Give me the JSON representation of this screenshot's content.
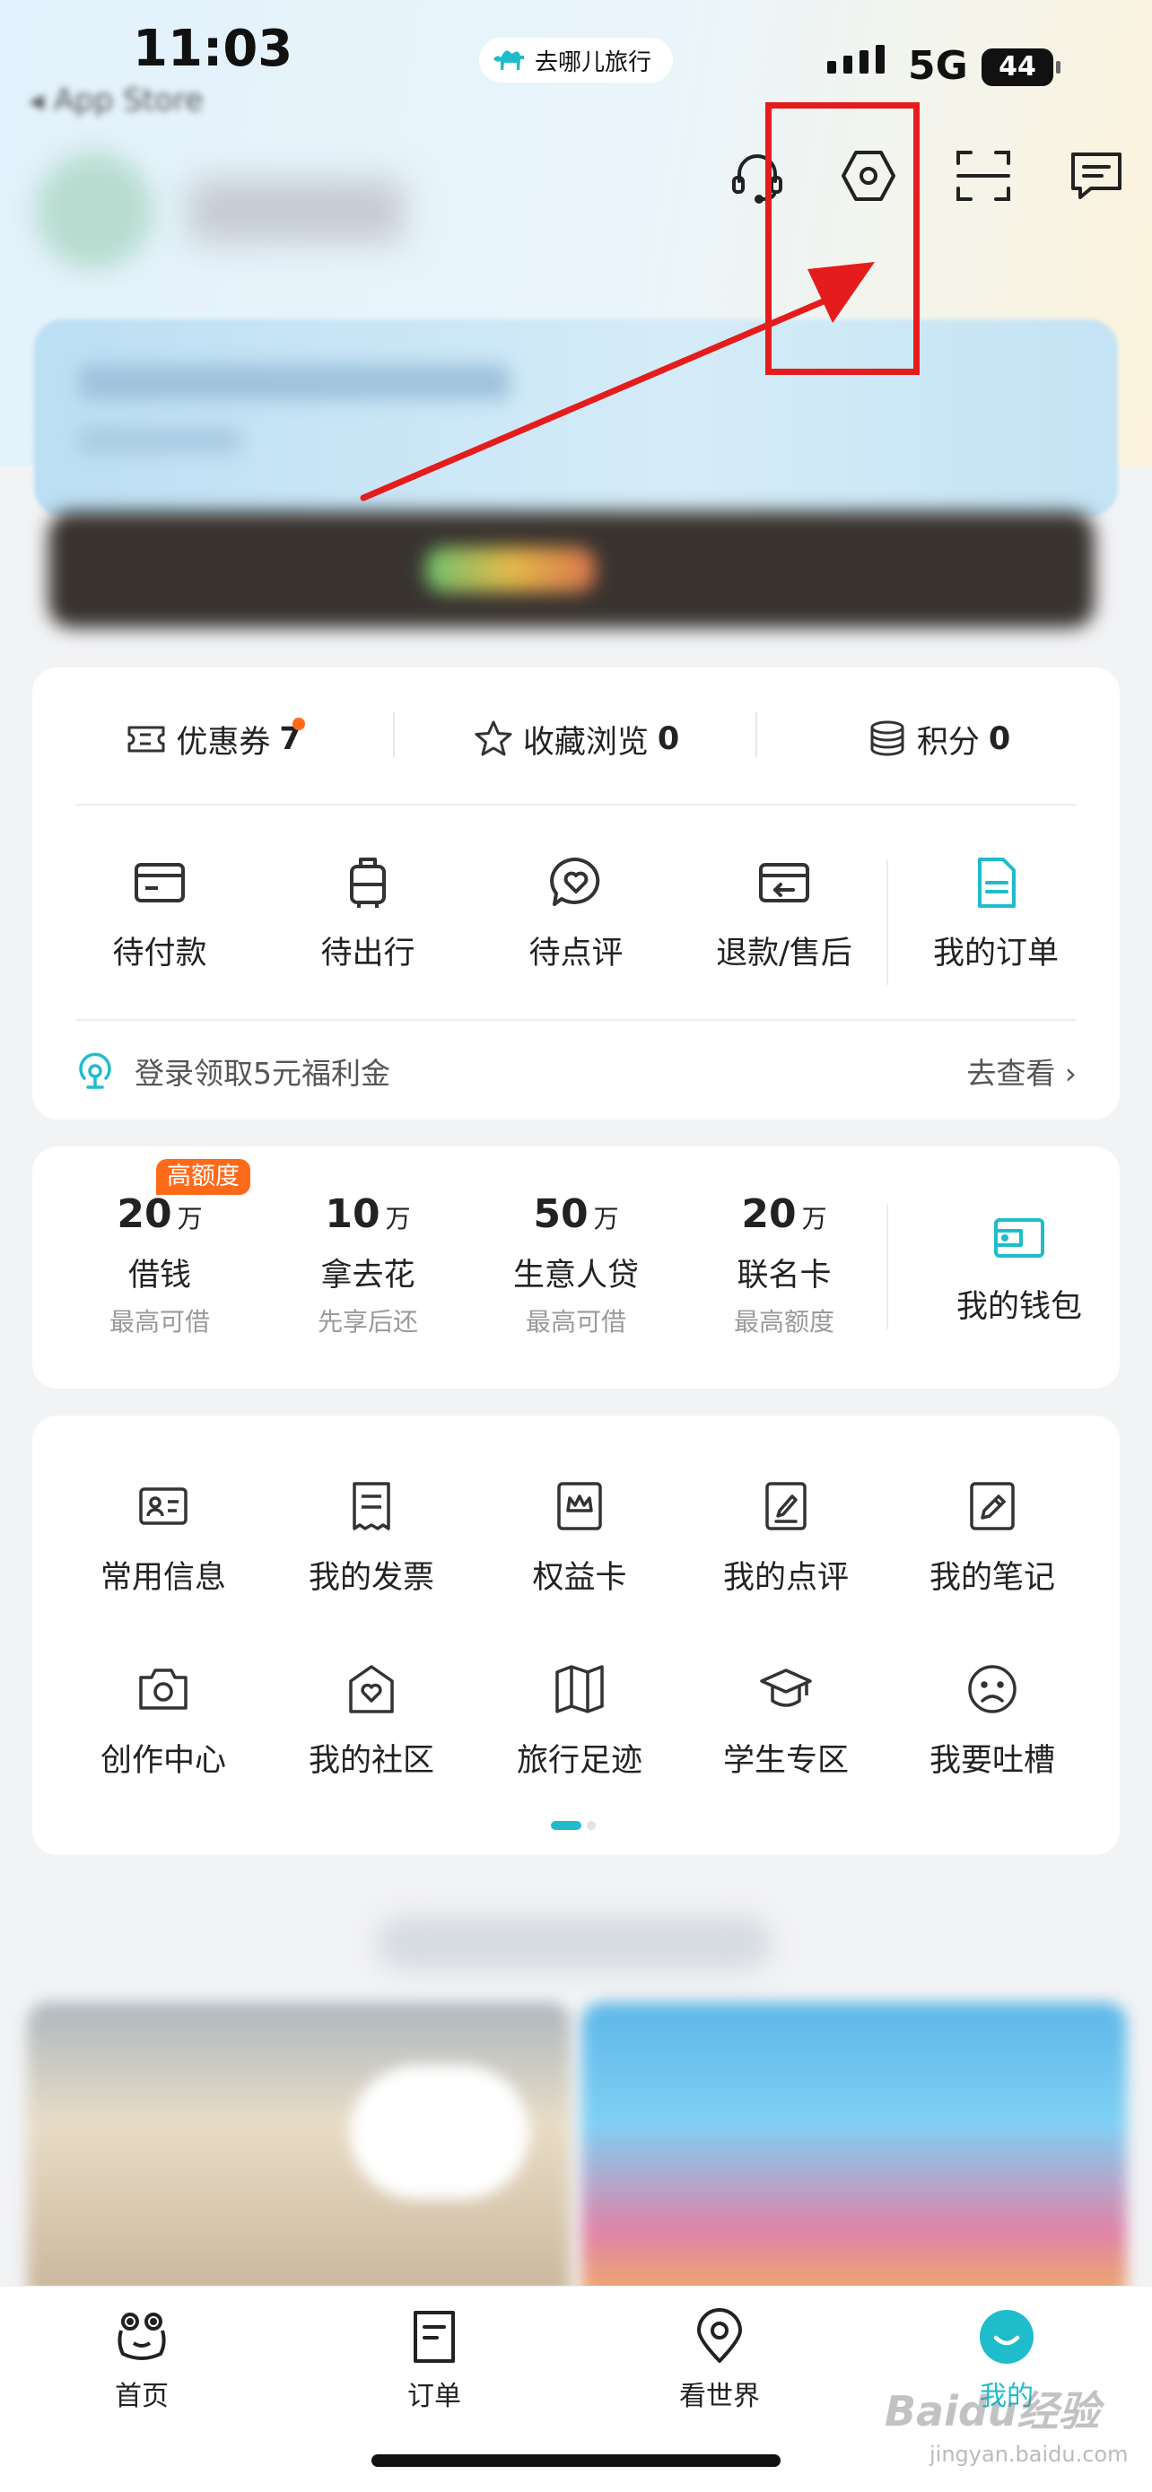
{
  "status_bar": {
    "time": "11:03",
    "back_label": "◂ App Store",
    "app_name": "去哪儿旅行",
    "network": "5G",
    "battery": "44"
  },
  "header": {
    "icons": [
      "headset-icon",
      "settings-icon",
      "scan-icon",
      "message-icon"
    ]
  },
  "stats": {
    "coupons_label": "优惠券",
    "coupons_count": "7",
    "favorites_label": "收藏浏览",
    "favorites_count": "0",
    "points_label": "积分",
    "points_count": "0"
  },
  "orders": {
    "items": [
      {
        "label": "待付款",
        "icon": "card-icon"
      },
      {
        "label": "待出行",
        "icon": "luggage-icon"
      },
      {
        "label": "待点评",
        "icon": "review-heart-icon"
      },
      {
        "label": "退款/售后",
        "icon": "refund-icon"
      },
      {
        "label": "我的订单",
        "icon": "order-doc-icon"
      }
    ],
    "promo_text": "登录领取5元福利金",
    "promo_link": "去查看 ›"
  },
  "finance": {
    "badge": "高额度",
    "items": [
      {
        "amount": "20",
        "unit": "万",
        "name": "借钱",
        "sub": "最高可借"
      },
      {
        "amount": "10",
        "unit": "万",
        "name": "拿去花",
        "sub": "先享后还"
      },
      {
        "amount": "50",
        "unit": "万",
        "name": "生意人贷",
        "sub": "最高可借"
      },
      {
        "amount": "20",
        "unit": "万",
        "name": "联名卡",
        "sub": "最高额度"
      }
    ],
    "wallet_label": "我的钱包"
  },
  "services": {
    "items": [
      {
        "label": "常用信息",
        "icon": "id-card-icon"
      },
      {
        "label": "我的发票",
        "icon": "invoice-icon"
      },
      {
        "label": "权益卡",
        "icon": "crown-card-icon"
      },
      {
        "label": "我的点评",
        "icon": "edit-doc-icon"
      },
      {
        "label": "我的笔记",
        "icon": "pencil-icon"
      },
      {
        "label": "创作中心",
        "icon": "camera-icon"
      },
      {
        "label": "我的社区",
        "icon": "community-heart-icon"
      },
      {
        "label": "旅行足迹",
        "icon": "map-icon"
      },
      {
        "label": "学生专区",
        "icon": "graduation-cap-icon"
      },
      {
        "label": "我要吐槽",
        "icon": "sad-face-icon"
      }
    ]
  },
  "tabbar": {
    "items": [
      {
        "label": "首页",
        "icon": "home-frog-icon"
      },
      {
        "label": "订单",
        "icon": "order-icon"
      },
      {
        "label": "看世界",
        "icon": "location-pin-icon"
      },
      {
        "label": "我的",
        "icon": "profile-smile-icon"
      }
    ],
    "active_index": 3
  },
  "watermark": {
    "main": "Baidu经验",
    "sub": "jingyan.baidu.com"
  },
  "colors": {
    "accent": "#1fbccc",
    "badge": "#ff6a1a",
    "annotation": "#e51c1c"
  }
}
